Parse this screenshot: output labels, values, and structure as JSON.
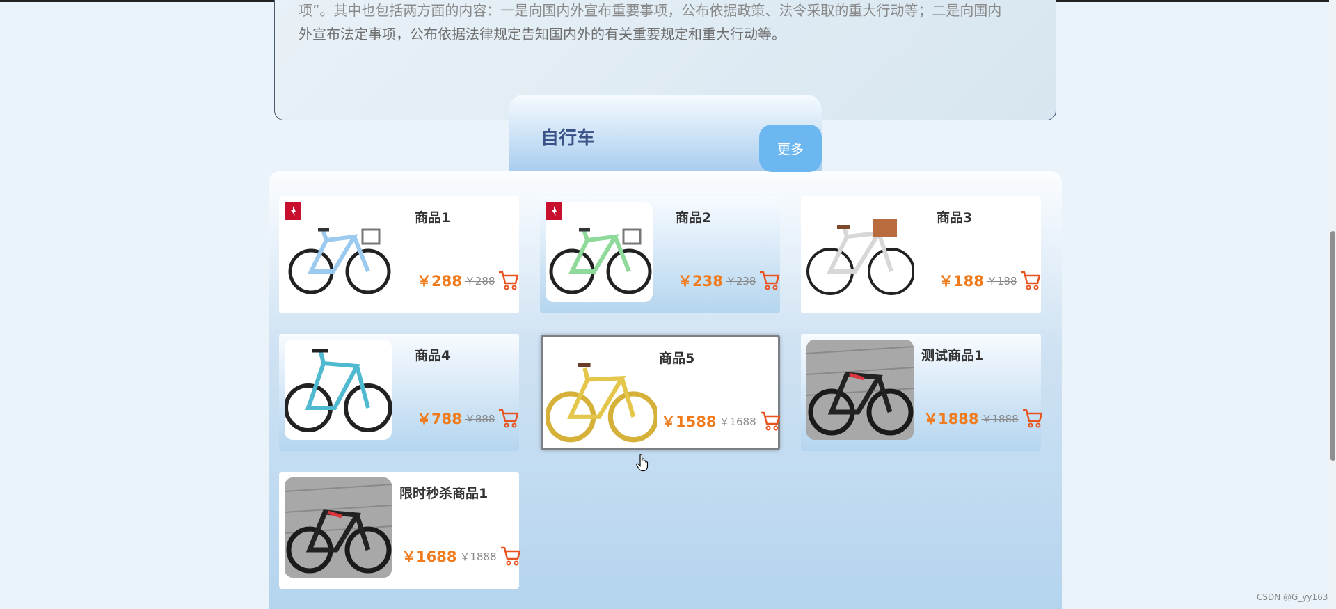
{
  "notice": {
    "line1": "项”。其中也包括两方面的内容：一是向国内外宣布重要事项，公布依据政策、法令采取的重大行动等；二是向国内",
    "line2": "外宣布法定事项，公布依据法律规定告知国内外的有关重要规定和重大行动等。"
  },
  "section": {
    "title": "自行车",
    "more_label": "更多"
  },
  "products": [
    {
      "name": "商品1",
      "price": "￥288",
      "old_price": "￥288",
      "bike_color": "#9cc9ee",
      "badge": true
    },
    {
      "name": "商品2",
      "price": "￥238",
      "old_price": "￥238",
      "bike_color": "#8fd99a",
      "badge": true
    },
    {
      "name": "商品3",
      "price": "￥188",
      "old_price": "￥188",
      "bike_color": "#d7d7d7",
      "badge": false
    },
    {
      "name": "商品4",
      "price": "￥788",
      "old_price": "￥888",
      "bike_color": "#4fb9cf",
      "badge": false
    },
    {
      "name": "商品5",
      "price": "￥1588",
      "old_price": "￥1688",
      "bike_color": "#e3c64a",
      "badge": false
    },
    {
      "name": "测试商品1",
      "price": "￥1888",
      "old_price": "￥1888",
      "bike_color": "#333333",
      "badge": false
    },
    {
      "name": "限时秒杀商品1",
      "price": "￥1688",
      "old_price": "￥1888",
      "bike_color": "#333333",
      "badge": false
    }
  ],
  "watermark": "CSDN @G_yy163",
  "colors": {
    "price": "#f07b1d",
    "title": "#3b5288",
    "more_button": "#6db7f0",
    "cart_icon": "#e8531f"
  },
  "icons": {
    "cart": "shopping-cart-icon",
    "badge": "brand-logo-icon",
    "cursor": "hand-pointer-icon"
  }
}
